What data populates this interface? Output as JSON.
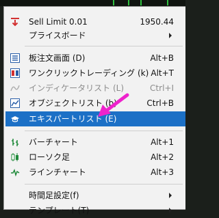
{
  "menu": {
    "items": [
      {
        "label": "Sell Limit 0.01",
        "shortcut": "1950.44",
        "icon": "sell-limit-icon"
      },
      {
        "label": "プライスボード",
        "submenu": true
      },
      {
        "label": "板注文画面 (D)",
        "shortcut": "Alt+B",
        "icon": "order-book-icon"
      },
      {
        "label": "ワンクリックトレーディング (k)",
        "shortcut": "Alt+T",
        "icon": "one-click-trading-icon"
      },
      {
        "label": "インディケータリスト (L)",
        "shortcut": "Ctrl+I",
        "icon": "indicator-list-icon",
        "disabled": true
      },
      {
        "label": "オブジェクトリスト (b)",
        "shortcut": "Ctrl+B",
        "icon": "object-list-icon"
      },
      {
        "label": "エキスパートリスト (E)",
        "icon": "expert-list-icon",
        "selected": true
      },
      {
        "label": "バーチャート",
        "shortcut": "Alt+1",
        "icon": "bar-chart-icon"
      },
      {
        "label": "ローソク足",
        "shortcut": "Alt+2",
        "icon": "candlestick-icon"
      },
      {
        "label": "ラインチャート",
        "shortcut": "Alt+3",
        "icon": "line-chart-icon"
      },
      {
        "label": "時間足設定(f)",
        "submenu": true
      },
      {
        "label": "テンプレート(T)",
        "submenu": true
      }
    ]
  },
  "colors": {
    "selected_bg": "#1c70c6",
    "annotation_arrow": "#ee22cc"
  }
}
